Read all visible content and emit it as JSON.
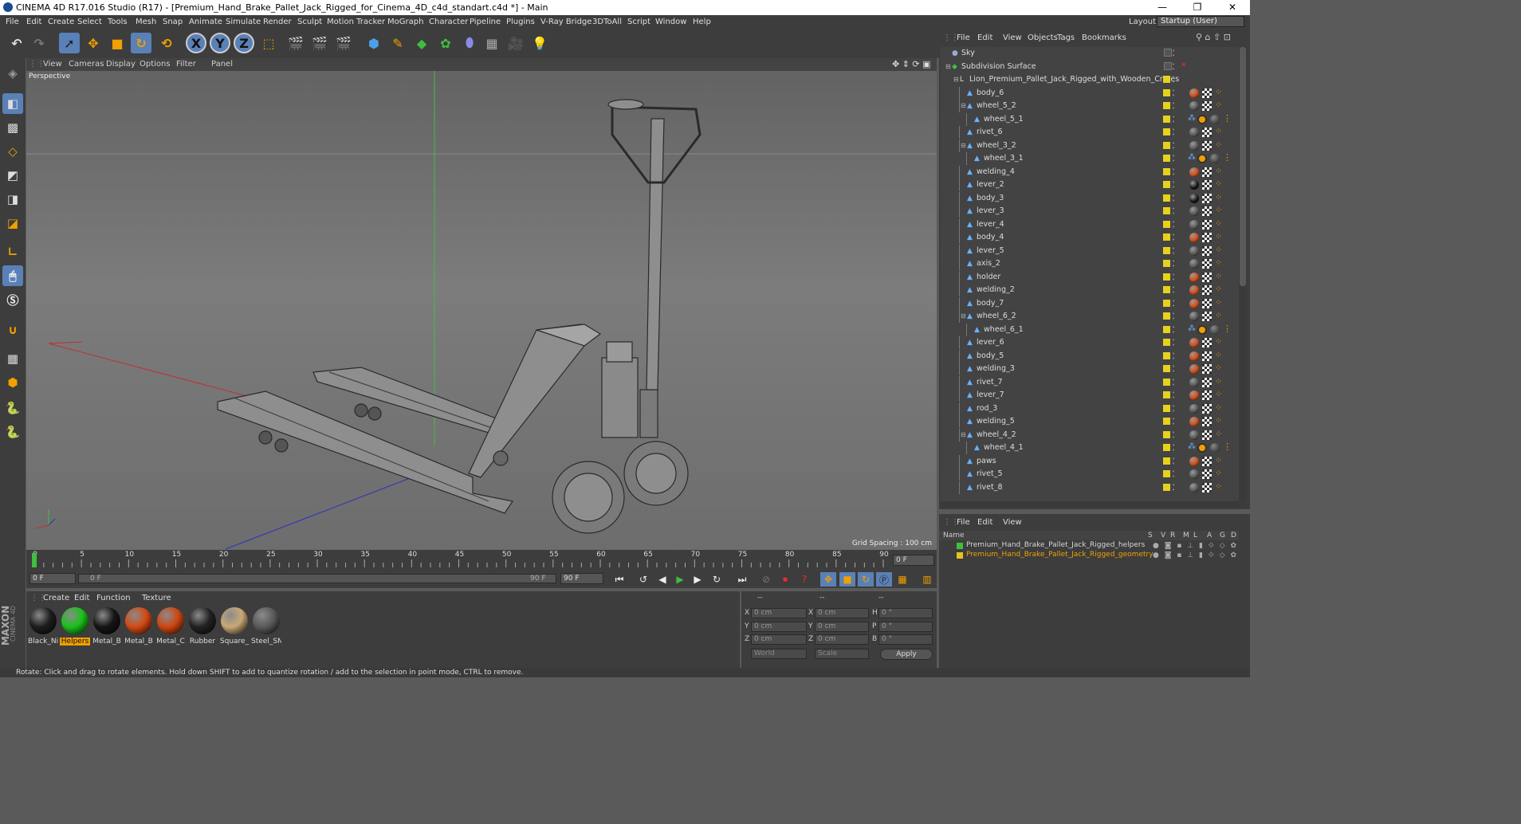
{
  "window": {
    "title": "CINEMA 4D R17.016 Studio (R17) - [Premium_Hand_Brake_Pallet_Jack_Rigged_for_Cinema_4D_c4d_standart.c4d *] - Main",
    "minimize": "—",
    "restore": "❐",
    "close": "✕"
  },
  "menubar": {
    "items": [
      "File",
      "Edit",
      "Create",
      "Select",
      "Tools",
      "Mesh",
      "Snap",
      "Animate",
      "Simulate",
      "Render",
      "Sculpt",
      "Motion Tracker",
      "MoGraph",
      "Character",
      "Pipeline",
      "Plugins",
      "V-Ray Bridge",
      "3DToAll",
      "Script",
      "Window",
      "Help"
    ],
    "layout_label": "Layout:",
    "layout_value": "Startup (User)"
  },
  "toolbar": {
    "x_label": "X",
    "y_label": "Y",
    "z_label": "Z"
  },
  "viewport": {
    "menu": [
      "View",
      "Cameras",
      "Display",
      "Options",
      "Filter",
      "Panel"
    ],
    "label": "Perspective",
    "grid_spacing": "Grid Spacing : 100 cm"
  },
  "timeline": {
    "ticks": [
      "0",
      "5",
      "10",
      "15",
      "20",
      "25",
      "30",
      "35",
      "40",
      "45",
      "50",
      "55",
      "60",
      "65",
      "70",
      "75",
      "80",
      "85",
      "90"
    ],
    "current_frame": "0 F",
    "start_field": "0 F",
    "range_start": "0 F",
    "range_end": "90 F",
    "end_field": "90 F"
  },
  "materials": {
    "menu": [
      "Create",
      "Edit",
      "Function",
      "Texture"
    ],
    "items": [
      {
        "label": "Black_Ni",
        "color": "#1d1d1d",
        "selected": false
      },
      {
        "label": "Helpers",
        "color": "#19c21a",
        "selected": true
      },
      {
        "label": "Metal_B",
        "color": "#151515",
        "selected": false
      },
      {
        "label": "Metal_B",
        "color": "#d44a14",
        "selected": false
      },
      {
        "label": "Metal_C",
        "color": "#cf4612",
        "selected": false
      },
      {
        "label": "Rubber",
        "color": "#222222",
        "selected": false
      },
      {
        "label": "Square_",
        "color": "#c9a878",
        "selected": false
      },
      {
        "label": "Steel_SN",
        "color": "#5a5a5a",
        "selected": false
      }
    ]
  },
  "coordinates": {
    "header": [
      "--",
      "--",
      "--"
    ],
    "rows": [
      {
        "a": "X",
        "av": "0 cm",
        "b": "X",
        "bv": "0 cm",
        "c": "H",
        "cv": "0 °"
      },
      {
        "a": "Y",
        "av": "0 cm",
        "b": "Y",
        "bv": "0 cm",
        "c": "P",
        "cv": "0 °"
      },
      {
        "a": "Z",
        "av": "0 cm",
        "b": "Z",
        "bv": "0 cm",
        "c": "B",
        "cv": "0 °"
      }
    ],
    "mode": "World",
    "scale": "Scale",
    "apply": "Apply"
  },
  "object_manager": {
    "menu": [
      "File",
      "Edit",
      "View",
      "Objects",
      "Tags",
      "Bookmarks"
    ],
    "objects": [
      {
        "name": "Sky",
        "depth": 0,
        "kind": "sky",
        "tag": null
      },
      {
        "name": "Subdivision Surface",
        "depth": 0,
        "kind": "subdiv",
        "tag": null
      },
      {
        "name": "Lion_Premium_Pallet_Jack_Rigged_with_Wooden_Crates",
        "depth": 1,
        "kind": "null",
        "tag": null
      },
      {
        "name": "body_6",
        "depth": 2,
        "kind": "joint",
        "tag": "#d44a14"
      },
      {
        "name": "wheel_5_2",
        "depth": 2,
        "kind": "joint",
        "tag": "#555555"
      },
      {
        "name": "wheel_5_1",
        "depth": 3,
        "kind": "joint",
        "tag": "#1d1d1d"
      },
      {
        "name": "rivet_6",
        "depth": 2,
        "kind": "joint",
        "tag": "#555555"
      },
      {
        "name": "wheel_3_2",
        "depth": 2,
        "kind": "joint",
        "tag": "#555555"
      },
      {
        "name": "wheel_3_1",
        "depth": 3,
        "kind": "joint",
        "tag": "#1d1d1d"
      },
      {
        "name": "welding_4",
        "depth": 2,
        "kind": "joint",
        "tag": "#d44a14"
      },
      {
        "name": "lever_2",
        "depth": 2,
        "kind": "joint",
        "tag": "#151515"
      },
      {
        "name": "body_3",
        "depth": 2,
        "kind": "joint",
        "tag": "#151515"
      },
      {
        "name": "lever_3",
        "depth": 2,
        "kind": "joint",
        "tag": "#555555"
      },
      {
        "name": "lever_4",
        "depth": 2,
        "kind": "joint",
        "tag": "#555555"
      },
      {
        "name": "body_4",
        "depth": 2,
        "kind": "joint",
        "tag": "#d44a14"
      },
      {
        "name": "lever_5",
        "depth": 2,
        "kind": "joint",
        "tag": "#555555"
      },
      {
        "name": "axis_2",
        "depth": 2,
        "kind": "joint",
        "tag": "#555555"
      },
      {
        "name": "holder",
        "depth": 2,
        "kind": "joint",
        "tag": "#d44a14"
      },
      {
        "name": "welding_2",
        "depth": 2,
        "kind": "joint",
        "tag": "#d44a14"
      },
      {
        "name": "body_7",
        "depth": 2,
        "kind": "joint",
        "tag": "#d44a14"
      },
      {
        "name": "wheel_6_2",
        "depth": 2,
        "kind": "joint",
        "tag": "#555555"
      },
      {
        "name": "wheel_6_1",
        "depth": 3,
        "kind": "joint",
        "tag": "#1d1d1d"
      },
      {
        "name": "lever_6",
        "depth": 2,
        "kind": "joint",
        "tag": "#d44a14"
      },
      {
        "name": "body_5",
        "depth": 2,
        "kind": "joint",
        "tag": "#d44a14"
      },
      {
        "name": "welding_3",
        "depth": 2,
        "kind": "joint",
        "tag": "#d44a14"
      },
      {
        "name": "rivet_7",
        "depth": 2,
        "kind": "joint",
        "tag": "#555555"
      },
      {
        "name": "lever_7",
        "depth": 2,
        "kind": "joint",
        "tag": "#d44a14"
      },
      {
        "name": "rod_3",
        "depth": 2,
        "kind": "joint",
        "tag": "#555555"
      },
      {
        "name": "welding_5",
        "depth": 2,
        "kind": "joint",
        "tag": "#d44a14"
      },
      {
        "name": "wheel_4_2",
        "depth": 2,
        "kind": "joint",
        "tag": "#555555"
      },
      {
        "name": "wheel_4_1",
        "depth": 3,
        "kind": "joint",
        "tag": "#1d1d1d"
      },
      {
        "name": "paws",
        "depth": 2,
        "kind": "joint",
        "tag": "#d44a14"
      },
      {
        "name": "rivet_5",
        "depth": 2,
        "kind": "joint",
        "tag": "#555555"
      },
      {
        "name": "rivet_8",
        "depth": 2,
        "kind": "joint",
        "tag": "#555555"
      }
    ]
  },
  "layer_manager": {
    "menu": [
      "File",
      "Edit",
      "View"
    ],
    "columns": [
      "Name",
      "S",
      "V",
      "R",
      "M",
      "L",
      "A",
      "G",
      "D"
    ],
    "layers": [
      {
        "name": "Premium_Hand_Brake_Pallet_Jack_Rigged_helpers",
        "color": "#3fbf3f",
        "text_color": "#d8d8d8"
      },
      {
        "name": "Premium_Hand_Brake_Pallet_Jack_Rigged_geometry",
        "color": "#e6c21e",
        "text_color": "#f0a000"
      }
    ]
  },
  "status": {
    "text": "Rotate: Click and drag to rotate elements. Hold down SHIFT to add to quantize rotation / add to the selection in point mode, CTRL to remove."
  },
  "branding": {
    "maxon": "MAXON",
    "cinema": "CINEMA 4D"
  }
}
